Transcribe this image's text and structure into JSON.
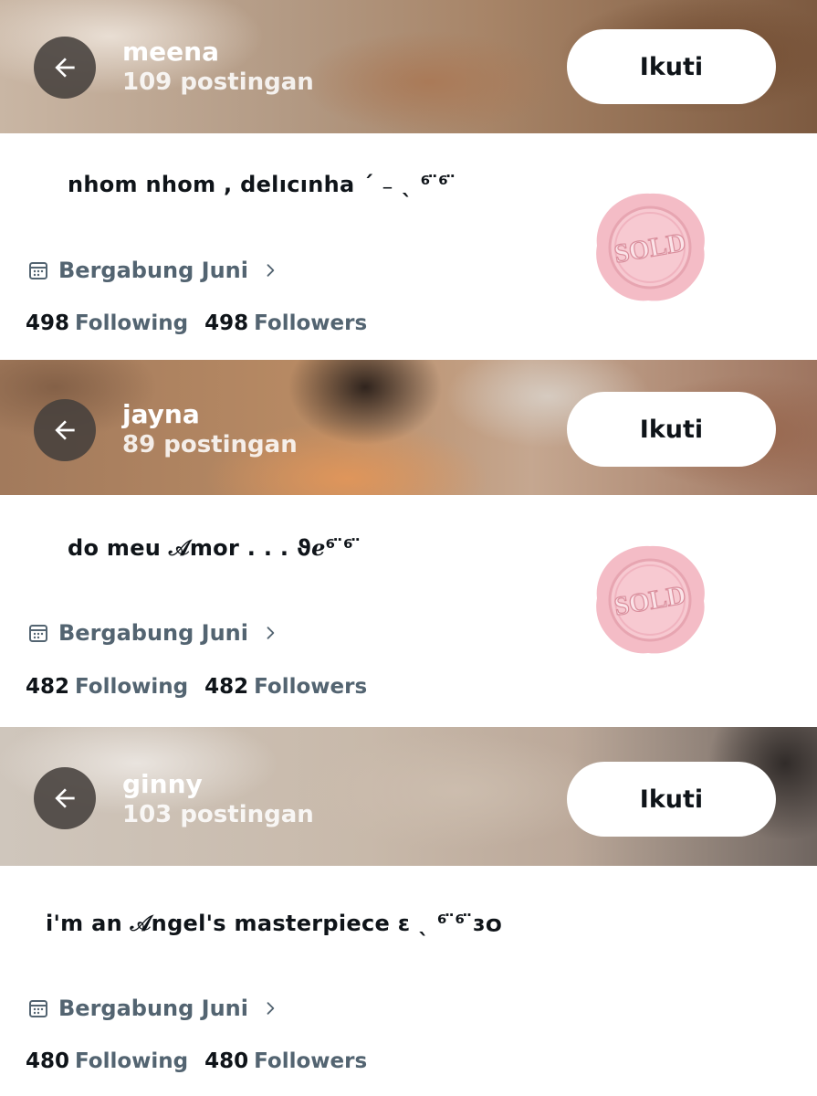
{
  "colors": {
    "follow_button_bg": "#ffffff",
    "back_button_bg": "#46403c",
    "secondary_text": "#536471",
    "primary_text": "#0f1419",
    "seal_pink": "#f4bcc6"
  },
  "profiles": [
    {
      "name": "meena",
      "posts": "109 postingan",
      "follow_label": "Ikuti",
      "bio": "nhom nhom , delıcınha ˊ ₋ ˎ ⁶ ̈⁶ ̈",
      "joined": "Bergabung Juni",
      "following_count": "498",
      "following_label": "Following",
      "followers_count": "498",
      "followers_label": "Followers",
      "seal_text": "SOLD",
      "icons": {
        "back": "arrow-left-icon",
        "calendar": "calendar-icon",
        "chevron": "chevron-right-icon"
      }
    },
    {
      "name": "jayna",
      "posts": "89 postingan",
      "follow_label": "Ikuti",
      "bio": "do meu 𝒜mor . . .  ϑℯ⁶ ̈⁶ ̈",
      "joined": "Bergabung Juni",
      "following_count": "482",
      "following_label": "Following",
      "followers_count": "482",
      "followers_label": "Followers",
      "seal_text": "SOLD",
      "icons": {
        "back": "arrow-left-icon",
        "calendar": "calendar-icon",
        "chevron": "chevron-right-icon"
      }
    },
    {
      "name": "ginny",
      "posts": "103 postingan",
      "follow_label": "Ikuti",
      "bio": "i'm an 𝒜ngel's masterpiece ɛ ˎ ⁶ ̈⁶ ̈ɜ໐",
      "joined": "Bergabung Juni",
      "following_count": "480",
      "following_label": "Following",
      "followers_count": "480",
      "followers_label": "Followers",
      "icons": {
        "back": "arrow-left-icon",
        "calendar": "calendar-icon",
        "chevron": "chevron-right-icon"
      }
    }
  ]
}
